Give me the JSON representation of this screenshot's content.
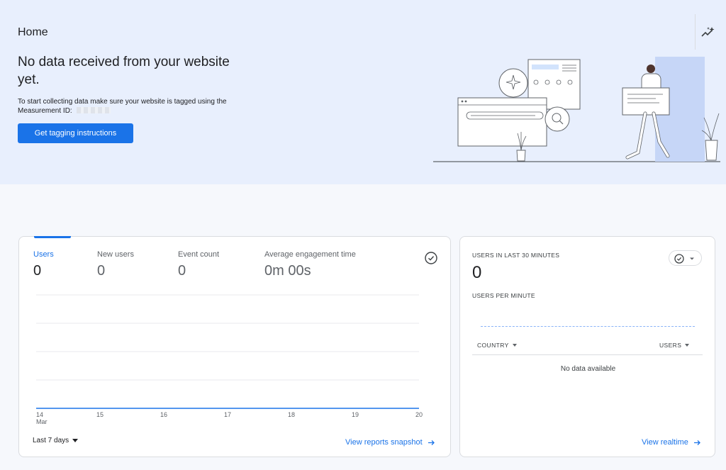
{
  "hero": {
    "title": "Home",
    "heading": "No data received from your website yet.",
    "subtext": "To start collecting data make sure your website is tagged using the Measurement ID:",
    "button_label": "Get tagging instructions",
    "insights_icon": "insights-sparkle-icon"
  },
  "overview": {
    "metrics": [
      {
        "label": "Users",
        "value": "0",
        "active": true
      },
      {
        "label": "New users",
        "value": "0",
        "active": false
      },
      {
        "label": "Event count",
        "value": "0",
        "active": false
      },
      {
        "label": "Average engagement time",
        "value": "0m 00s",
        "active": false
      }
    ],
    "date_range": "Last 7 days",
    "view_link": "View reports snapshot",
    "line_color": "#1a73e8"
  },
  "chart_data": {
    "type": "line",
    "x": [
      "14",
      "15",
      "16",
      "17",
      "18",
      "19",
      "20"
    ],
    "x_month_label": "Mar",
    "series": [
      {
        "values": [
          0,
          0,
          0,
          0,
          0,
          0,
          0
        ]
      }
    ],
    "grid": true
  },
  "realtime": {
    "title": "USERS IN LAST 30 MINUTES",
    "value": "0",
    "per_minute_label": "USERS PER MINUTE",
    "col_country": "COUNTRY",
    "col_users": "USERS",
    "empty_text": "No data available",
    "view_link": "View realtime"
  },
  "colors": {
    "accent": "#1a73e8",
    "hero_bg": "#e8effd"
  }
}
